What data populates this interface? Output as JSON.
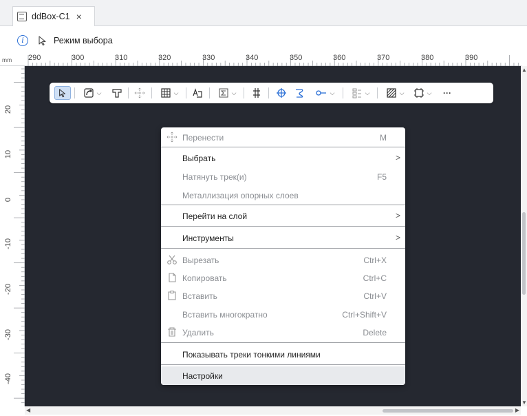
{
  "tab": {
    "label": "ddBox-C1",
    "close": "×",
    "icon": "board-icon"
  },
  "modebar": {
    "label": "Режим выбора",
    "icon": "cursor-icon"
  },
  "ruler": {
    "unit": "mm",
    "h_ticks": [
      "290",
      "300",
      "310",
      "320",
      "330",
      "340",
      "350",
      "360",
      "370",
      "380",
      "390"
    ],
    "v_ticks": [
      "20",
      "10",
      "0",
      "-10",
      "-20",
      "-30",
      "-40"
    ]
  },
  "toolbar": {
    "items": [
      "select-icon",
      "route-icon",
      "track-icon",
      "move-icon",
      "grid-icon",
      "text-icon",
      "sum-icon",
      "diff-pair-icon",
      "via-icon",
      "tune-icon",
      "probe-icon",
      "align-icon",
      "fill-icon",
      "frame-icon",
      "more-icon"
    ],
    "more_label": "···"
  },
  "menu": {
    "items": [
      {
        "label": "Перенести",
        "shortcut": "M",
        "icon": "move-icon",
        "enabled": false
      },
      {
        "label": "Выбрать",
        "submenu": ">",
        "enabled": true
      },
      {
        "label": "Натянуть трек(и)",
        "shortcut": "F5",
        "enabled": false
      },
      {
        "label": "Металлизация опорных слоев",
        "enabled": false
      },
      {
        "label": "Перейти на слой",
        "submenu": ">",
        "enabled": true
      },
      {
        "label": "Инструменты",
        "submenu": ">",
        "enabled": true
      },
      {
        "label": "Вырезать",
        "shortcut": "Ctrl+X",
        "icon": "scissors-icon",
        "enabled": false
      },
      {
        "label": "Копировать",
        "shortcut": "Ctrl+C",
        "icon": "copy-icon",
        "enabled": false
      },
      {
        "label": "Вставить",
        "shortcut": "Ctrl+V",
        "icon": "paste-icon",
        "enabled": false
      },
      {
        "label": "Вставить многократно",
        "shortcut": "Ctrl+Shift+V",
        "enabled": false
      },
      {
        "label": "Удалить",
        "shortcut": "Delete",
        "icon": "trash-icon",
        "enabled": false
      },
      {
        "label": "Показывать треки тонкими линиями",
        "enabled": true
      },
      {
        "label": "Настройки",
        "enabled": true,
        "hover": true
      }
    ]
  },
  "colors": {
    "canvas": "#252830",
    "accent": "#2a6fd6",
    "active_tool": "#cfe0f5"
  }
}
